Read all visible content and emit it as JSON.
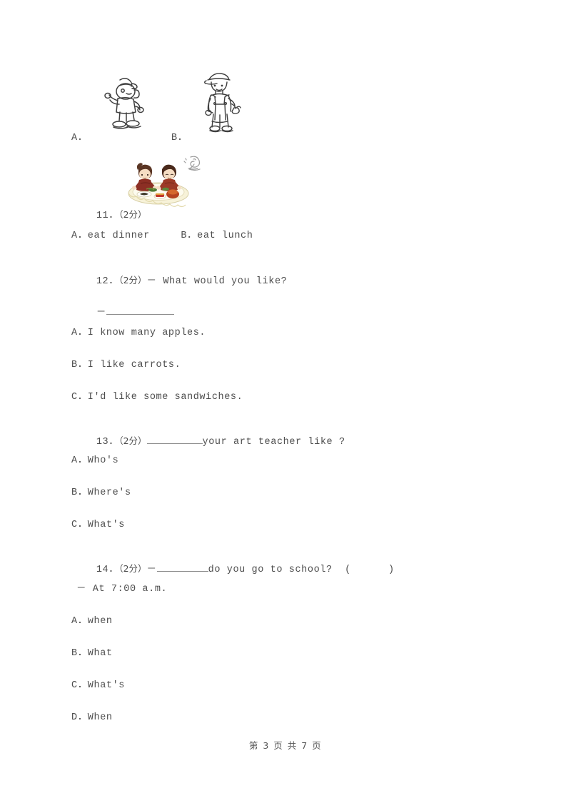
{
  "document": {
    "type": "exam-worksheet",
    "language": "en-zh",
    "page_background": "#ffffff",
    "text_color": "#4d4d4d",
    "rule_color": "#8d8d8d"
  },
  "options_above_q11": {
    "option_a_label": "A．",
    "option_b_label": "B．",
    "figure_a_name": "cartoon-child-in-cap",
    "figure_b_name": "cartoon-man-in-overalls"
  },
  "questions": [
    {
      "number": "11．",
      "points": "（2分）",
      "figure_name": "children-eating-dinner-illustration",
      "stem": "",
      "options_inline": "A．eat dinner     B．eat lunch"
    },
    {
      "number": "12．",
      "points": "（2分）",
      "stem": "－ What would you like?",
      "answer_line_prefix": "－",
      "answer_line_blank": true,
      "options": [
        "A．I know many apples.",
        "B．I like carrots.",
        "C．I'd like some sandwiches."
      ]
    },
    {
      "number": "13．",
      "points": "（2分）",
      "stem_after_blank": "your art teacher like ?",
      "options": [
        "A．Who's",
        "B．Where's",
        "C．What's"
      ]
    },
    {
      "number": "14．",
      "points": "（2分）",
      "stem_prefix": "－",
      "stem_after_blank": "do you go to school?  (      )",
      "answer_line": "－ At 7:00 a.m.",
      "options": [
        "A．when",
        "B．What",
        "C．What's",
        "D．When"
      ]
    }
  ],
  "footer": {
    "text": "第 3 页 共 7 页"
  }
}
